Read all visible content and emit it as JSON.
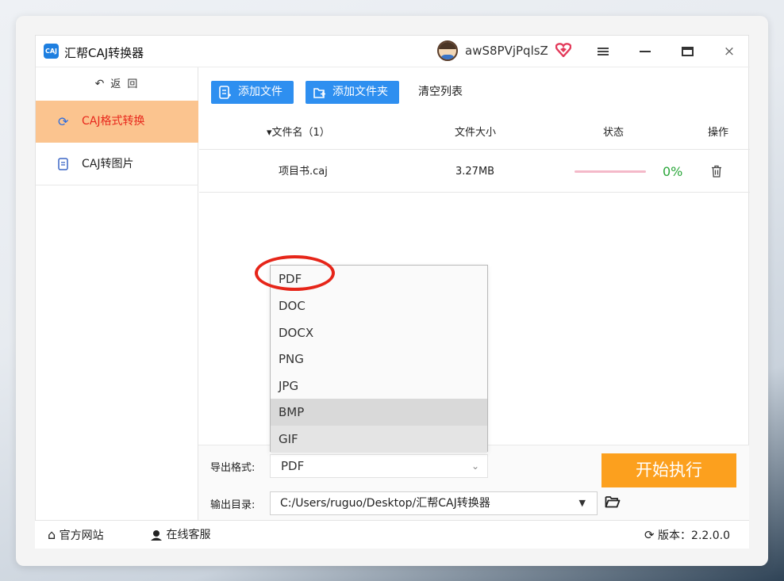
{
  "app": {
    "title": "汇帮CAJ转换器",
    "icon_text": "CAJ"
  },
  "user": {
    "name": "awS8PVjPqlsZ",
    "vip_icon": "heart-diamond-icon"
  },
  "window_controls": [
    "menu-icon",
    "minimize-icon",
    "maximize-icon",
    "close-icon"
  ],
  "close_glyph": "×",
  "sidebar": {
    "back_label": "返 回",
    "items": [
      {
        "label": "CAJ格式转换",
        "icon": "refresh-icon",
        "active": true
      },
      {
        "label": "CAJ转图片",
        "icon": "document-icon",
        "active": false
      }
    ]
  },
  "toolbar": {
    "add_file": "添加文件",
    "add_folder": "添加文件夹",
    "clear": "清空列表"
  },
  "table": {
    "headers": [
      "▾文件名（1）",
      "文件大小",
      "状态",
      "操作"
    ],
    "rows": [
      {
        "name": "项目书.caj",
        "size": "3.27MB",
        "progress": 0,
        "progress_text": "0%"
      }
    ]
  },
  "format_dropdown": {
    "options": [
      "PDF",
      "DOC",
      "DOCX",
      "PNG",
      "JPG",
      "BMP",
      "GIF"
    ],
    "highlighted": "BMP",
    "circled": "PDF"
  },
  "form": {
    "format_label": "导出格式:",
    "format_value": "PDF",
    "dir_label": "输出目录:",
    "dir_value": "C:/Users/ruguo/Desktop/汇帮CAJ转换器"
  },
  "start_button": "开始执行",
  "statusbar": {
    "website": "官方网站",
    "service": "在线客服",
    "version": "版本：2.2.0.0"
  },
  "colors": {
    "accent_blue": "#2e8ff0",
    "active_nav_bg": "#fbc48f",
    "active_nav_text": "#e8281c",
    "start_button": "#fca01e",
    "progress_green": "#2aa63a",
    "annotation_red": "#e62519"
  }
}
